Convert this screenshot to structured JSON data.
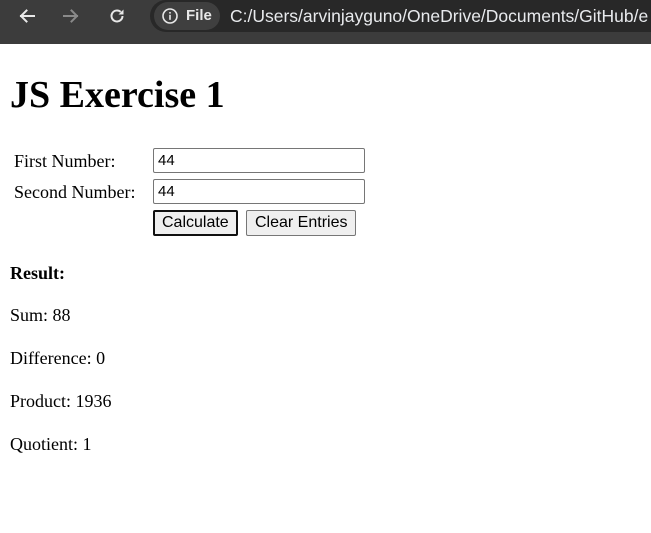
{
  "browser": {
    "back_icon": "arrow-left-icon",
    "forward_icon": "arrow-right-icon",
    "reload_icon": "reload-icon",
    "site_info_icon": "info-circle-icon",
    "scheme_label": "File",
    "url": "C:/Users/arvinjayguno/OneDrive/Documents/GitHub/e"
  },
  "main": {
    "title": "JS Exercise 1",
    "form": {
      "first_label": "First Number:",
      "first_value": "44",
      "second_label": "Second Number:",
      "second_value": "44",
      "calculate_label": "Calculate",
      "clear_label": "Clear Entries"
    },
    "result": {
      "heading": "Result:",
      "sum": "Sum: 88",
      "difference": "Difference: 0",
      "product": "Product: 1936",
      "quotient": "Quotient: 1"
    }
  }
}
